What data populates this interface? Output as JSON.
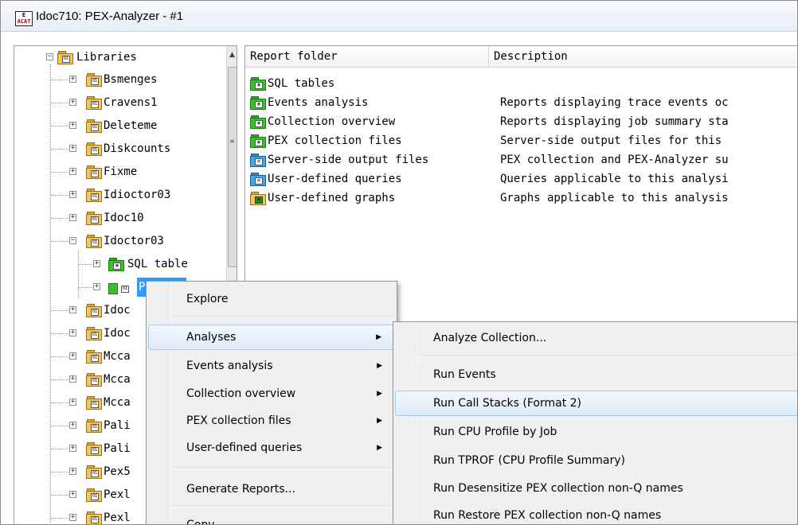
{
  "window": {
    "title": "Idoc710:  PEX-Analyzer - #1",
    "icon_top": "E",
    "icon_bottom": "ACAT"
  },
  "tree": {
    "root_label": "Libraries",
    "items": [
      {
        "label": "Bsmenges",
        "expander": "+"
      },
      {
        "label": "Cravens1",
        "expander": "+"
      },
      {
        "label": "Deleteme",
        "expander": "+"
      },
      {
        "label": "Diskcounts",
        "expander": "+"
      },
      {
        "label": "Fixme",
        "expander": "+"
      },
      {
        "label": "Idioctor03",
        "expander": "+"
      },
      {
        "label": "Idoc10",
        "expander": "+"
      },
      {
        "label": "Idoctor03",
        "expander": "−"
      }
    ],
    "child_sql": "SQL table",
    "child_selected": "P",
    "more_items": [
      "Idoc",
      "Idoc",
      "Mcca",
      "Mcca",
      "Mcca",
      "Pali",
      "Pali",
      "Pex5",
      "Pexl",
      "Pexl"
    ]
  },
  "list": {
    "columns": [
      "Report folder",
      "Description"
    ],
    "rows": [
      {
        "name": "SQL tables",
        "desc": "",
        "icon": "green"
      },
      {
        "name": "Events analysis",
        "desc": "Reports displaying trace events oc",
        "icon": "green"
      },
      {
        "name": "Collection overview",
        "desc": "Reports displaying job summary sta",
        "icon": "green"
      },
      {
        "name": "PEX collection files",
        "desc": "Server-side output files for this",
        "icon": "green"
      },
      {
        "name": "Server-side output files",
        "desc": "PEX collection and PEX-Analyzer su",
        "icon": "blue"
      },
      {
        "name": "User-defined queries",
        "desc": "Queries applicable to this analysi",
        "icon": "blue"
      },
      {
        "name": "User-defined graphs",
        "desc": "Graphs applicable to this analysis",
        "icon": "tgreen"
      }
    ]
  },
  "context_menu": {
    "items": [
      {
        "label": "Explore",
        "submenu": false
      },
      {
        "label": "Analyses",
        "submenu": true
      },
      {
        "label": "Events analysis",
        "submenu": true
      },
      {
        "label": "Collection overview",
        "submenu": true
      },
      {
        "label": "PEX collection files",
        "submenu": true
      },
      {
        "label": "User-defined queries",
        "submenu": true
      },
      {
        "label": "Generate Reports...",
        "submenu": false
      },
      {
        "label": "Copy",
        "submenu": false
      }
    ]
  },
  "submenu": {
    "items": [
      "Analyze Collection...",
      "Run Events",
      "Run Call Stacks (Format 2)",
      "Run CPU Profile by Job",
      "Run TPROF (CPU Profile Summary)",
      "Run Desensitize PEX collection non-Q names",
      "Run Restore PEX collection non-Q names"
    ]
  },
  "colors": {
    "selection": "#3399ff",
    "menu_highlight_border": "#a9c7ee",
    "menu_background": "#f0f0f0"
  }
}
